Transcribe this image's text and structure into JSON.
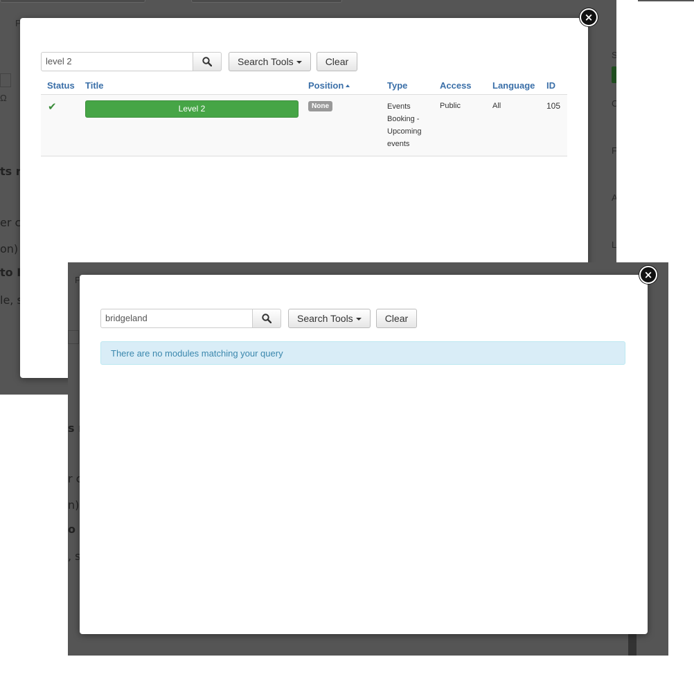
{
  "modal_a": {
    "search": {
      "value": "level 2",
      "placeholder": ""
    },
    "search_tools_label": "Search Tools",
    "clear_label": "Clear",
    "columns": [
      "Status",
      "Title",
      "Position",
      "Type",
      "Access",
      "Language",
      "ID"
    ],
    "rows": [
      {
        "status": "✔",
        "title": "Level 2",
        "position": "None",
        "type_lines": [
          "Events",
          "Booking -",
          "Upcoming",
          "events"
        ],
        "access": "Public",
        "language": "All",
        "id": "105"
      }
    ]
  },
  "modal_b": {
    "search": {
      "value": "bridgeland",
      "placeholder": ""
    },
    "search_tools_label": "Search Tools",
    "clear_label": "Clear",
    "alert": "There are no modules matching your query"
  },
  "close_glyph": "×",
  "colors": {
    "backdrop": "#555555",
    "published_green": "#46a546",
    "column_header_blue": "#3a6fa8",
    "info_alert_bg": "#d9edf7",
    "info_alert_text": "#3a87ad"
  },
  "icons": {
    "search": "search-icon",
    "close": "close-icon",
    "caret": "caret-down-icon",
    "published": "check-icon",
    "sort": "sort-asc-icon"
  }
}
